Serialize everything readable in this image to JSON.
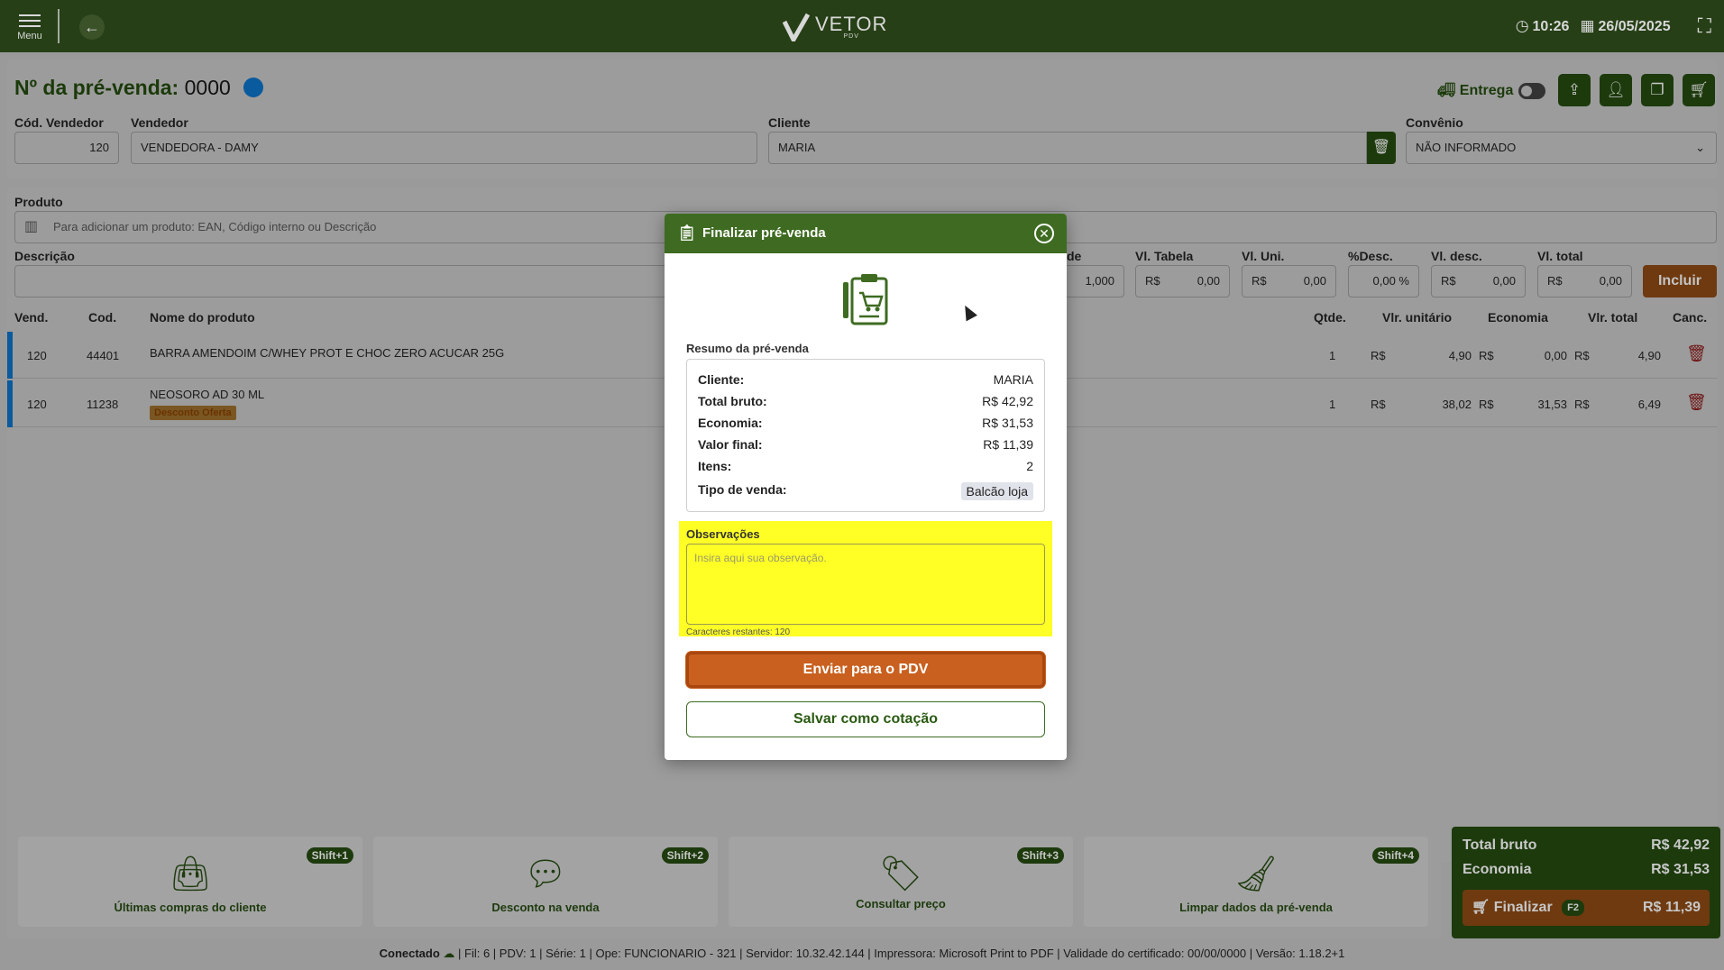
{
  "topbar": {
    "menu_label": "Menu",
    "logo_text": "VETOR",
    "logo_sub": "PDV",
    "time": "10:26",
    "date": "26/05/2025"
  },
  "header": {
    "title_prefix": "Nº da pré-venda:",
    "title_number": "0000",
    "entrega_label": "Entrega"
  },
  "form": {
    "cod_vendedor_label": "Cód. Vendedor",
    "cod_vendedor_value": "120",
    "vendedor_label": "Vendedor",
    "vendedor_value": "VENDEDORA - DAMY",
    "cliente_label": "Cliente",
    "cliente_value": "MARIA",
    "convenio_label": "Convênio",
    "convenio_value": "NÃO INFORMADO",
    "produto_label": "Produto",
    "produto_placeholder": "Para adicionar um produto: EAN, Código interno ou Descrição",
    "descricao_label": "Descrição",
    "qtde_label_partial": "de",
    "qtde_value": "1,000",
    "vl_tabela_label": "Vl. Tabela",
    "vl_uni_label": "Vl. Uni.",
    "desc_pct_label": "%Desc.",
    "vl_desc_label": "Vl. desc.",
    "vl_total_label": "Vl. total",
    "currency": "R$",
    "zero_value": "0,00",
    "zero_pct": "0,00 %",
    "incluir_label": "Incluir"
  },
  "table": {
    "headers": {
      "vend": "Vend.",
      "cod": "Cod.",
      "nome": "Nome do produto",
      "qtde": "Qtde.",
      "vlr_unitario": "Vlr. unitário",
      "economia": "Economia",
      "vlr_total": "Vlr. total",
      "canc": "Canc."
    },
    "rows": [
      {
        "vend": "120",
        "cod": "44401",
        "nome": "BARRA AMENDOIM C/WHEY PROT E CHOC ZERO ACUCAR 25G",
        "badge": "",
        "qtde": "1",
        "unit": "4,90",
        "eco": "0,00",
        "total": "4,90"
      },
      {
        "vend": "120",
        "cod": "11238",
        "nome": "NEOSORO AD 30 ML",
        "badge": "Desconto Oferta",
        "qtde": "1",
        "unit": "38,02",
        "eco": "31,53",
        "total": "6,49"
      }
    ]
  },
  "actions": [
    {
      "label": "Últimas compras do cliente",
      "shortcut": "Shift+1",
      "icon": "shopping-bag-clock-icon"
    },
    {
      "label": "Desconto na venda",
      "shortcut": "Shift+2",
      "icon": "discount-bubble-icon"
    },
    {
      "label": "Consultar preço",
      "shortcut": "Shift+3",
      "icon": "price-tag-search-icon"
    },
    {
      "label": "Limpar dados da pré-venda",
      "shortcut": "Shift+4",
      "icon": "broom-icon"
    }
  ],
  "totals": {
    "total_bruto_label": "Total bruto",
    "total_bruto_value": "R$ 42,92",
    "economia_label": "Economia",
    "economia_value": "R$ 31,53",
    "finalizar_label": "Finalizar",
    "finalizar_key": "F2",
    "finalizar_value": "R$ 11,39"
  },
  "statusbar": {
    "conectado": "Conectado",
    "info": "| Fil: 6 | PDV: 1 | Série: 1 | Ope: FUNCIONARIO - 321 | Servidor: 10.32.42.144 | Impressora: Microsoft Print to PDF | Validade do certificado: 00/00/0000 | Versão: 1.18.2+1"
  },
  "modal": {
    "title": "Finalizar pré-venda",
    "section_title": "Resumo da pré-venda",
    "summary": [
      {
        "key": "Cliente:",
        "value": "MARIA"
      },
      {
        "key": "Total bruto:",
        "value": "R$ 42,92"
      },
      {
        "key": "Economia:",
        "value": "R$ 31,53"
      },
      {
        "key": "Valor final:",
        "value": "R$ 11,39"
      },
      {
        "key": "Itens:",
        "value": "2"
      }
    ],
    "tipo_venda_label": "Tipo de venda:",
    "tipo_venda_value": "Balcão loja",
    "obs_label": "Observações",
    "obs_placeholder": "Insira aqui sua observação.",
    "obs_value": "",
    "obs_counter": "Caracteres restantes: 120",
    "send_button": "Enviar para o PDV",
    "save_button": "Salvar como cotação"
  },
  "colors": {
    "brand_green": "#3e6b21",
    "accent_orange": "#c9601f",
    "highlight_yellow": "#ffff26",
    "row_marker_blue": "#0a5a9e"
  }
}
